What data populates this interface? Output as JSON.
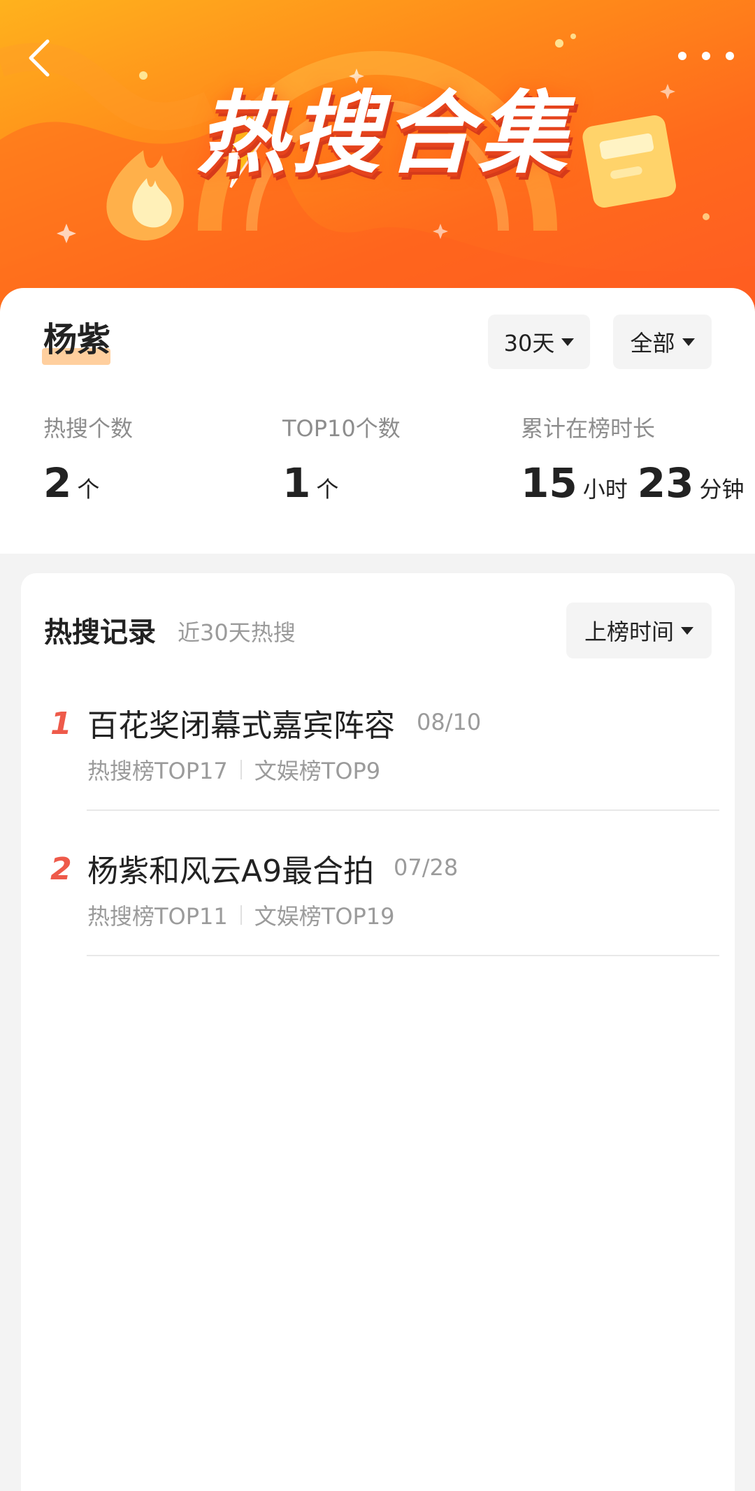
{
  "banner": {
    "title": "热搜合集",
    "back_icon": "chevron-left-icon",
    "more_icon": "more-dots-icon"
  },
  "summary": {
    "name": "杨紫",
    "filters": {
      "range": "30天",
      "scope": "全部"
    },
    "stats": [
      {
        "label": "热搜个数",
        "value": "2",
        "unit": "个"
      },
      {
        "label": "TOP10个数",
        "value": "1",
        "unit": "个"
      },
      {
        "label": "累计在榜时长",
        "hours": "15",
        "hours_unit": "小时",
        "minutes": "23",
        "minutes_unit": "分钟"
      }
    ]
  },
  "records": {
    "title": "热搜记录",
    "subtitle": "近30天热搜",
    "sort_label": "上榜时间",
    "items": [
      {
        "rank": "1",
        "name": "百花奖闭幕式嘉宾阵容",
        "date": "08/10",
        "hot_rank": "热搜榜TOP17",
        "ent_rank": "文娱榜TOP9"
      },
      {
        "rank": "2",
        "name": "杨紫和风云A9最合拍",
        "date": "07/28",
        "hot_rank": "热搜榜TOP11",
        "ent_rank": "文娱榜TOP19"
      }
    ]
  },
  "colors": {
    "banner_start": "#ffb21d",
    "banner_end": "#ff5a24",
    "rank": "#ee5a4a",
    "name_highlight": "#ffcf9e"
  }
}
